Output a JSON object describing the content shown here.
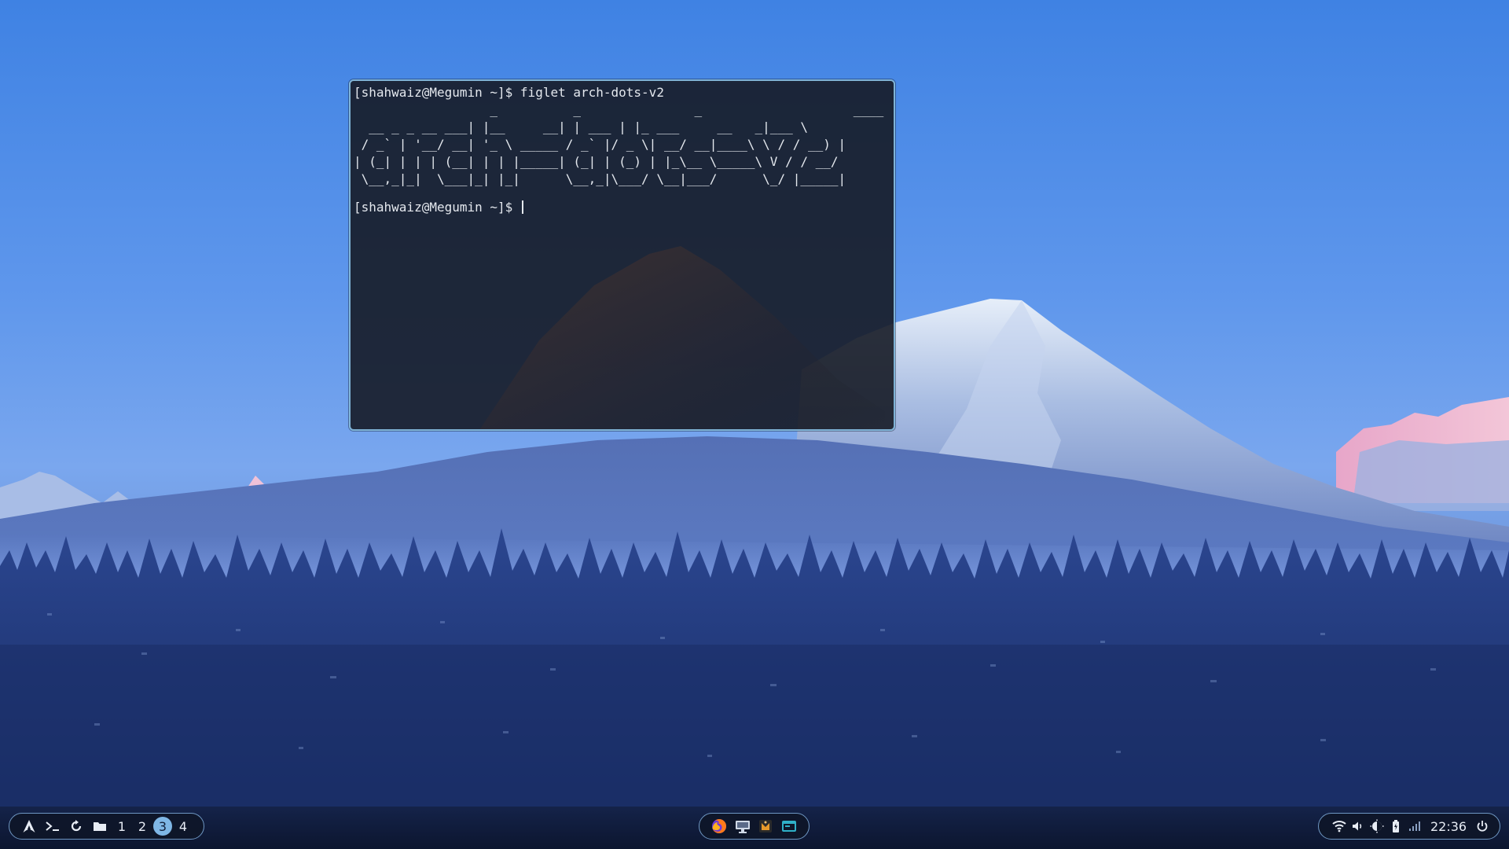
{
  "terminal": {
    "command_line": "[shahwaiz@Megumin ~]$ figlet arch-dots-v2",
    "figlet_art": "                  _          _               _                    ____  \n  __ _ _ __ ___| |__     __| | ___ | |_ ___     __   _|___ \\ \n / _` | '__/ __| '_ \\ _____ / _` |/ _ \\| __/ __|____\\ \\ / / __) |\n| (_| | | | (__| | | |_____| (_| | (_) | |_\\__ \\_____\\ V / / __/ \n \\__,_|_|  \\___|_| |_|      \\__,_|\\___/ \\__|___/      \\_/ |_____|",
    "prompt": "[shahwaiz@Megumin ~]$ "
  },
  "panel": {
    "left": {
      "launcher_icon": "arch-logo-icon",
      "terminal_icon": "terminal-prompt-icon",
      "refresh_icon": "refresh-icon",
      "files_icon": "folder-icon",
      "workspaces": [
        "1",
        "2",
        "3",
        "4"
      ],
      "active_workspace": "3"
    },
    "center": {
      "apps": [
        "firefox-icon",
        "screen-capture-icon",
        "media-player-icon",
        "window-manager-icon"
      ]
    },
    "right": {
      "tray": [
        "wifi-icon",
        "volume-icon",
        "brightness-icon",
        "battery-icon",
        "signal-icon"
      ],
      "clock": "22:36",
      "power_icon": "power-icon"
    }
  },
  "colors": {
    "accent": "#7fb7e6",
    "pill_border": "#6f98c4",
    "terminal_border": "#7fb3d6",
    "terminal_bg": "#161b26",
    "terminal_text": "#e4e8ee"
  }
}
